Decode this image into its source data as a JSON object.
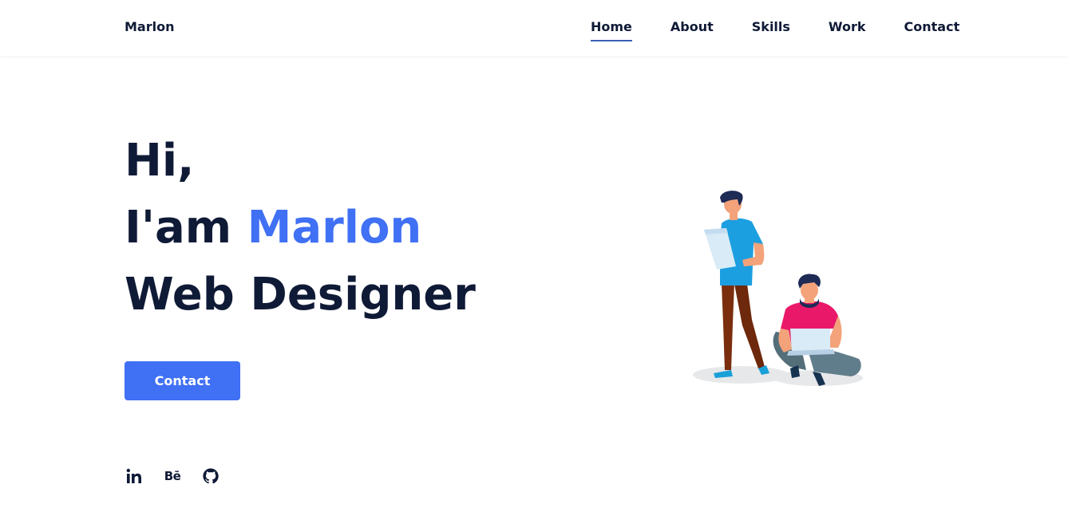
{
  "header": {
    "logo": "Marlon",
    "nav": [
      {
        "label": "Home",
        "active": true
      },
      {
        "label": "About",
        "active": false
      },
      {
        "label": "Skills",
        "active": false
      },
      {
        "label": "Work",
        "active": false
      },
      {
        "label": "Contact",
        "active": false
      }
    ]
  },
  "hero": {
    "line1": "Hi,",
    "line2_prefix": "I'am ",
    "line2_name": "Marlon",
    "line3": "Web Designer",
    "button_label": "Contact"
  },
  "social": {
    "linkedin_icon": "linkedin-icon",
    "behance_label": "Bē",
    "github_icon": "github-icon"
  },
  "colors": {
    "accent": "#4070f4",
    "text": "#0f1a36",
    "nav_underline": "#3a5fb0"
  }
}
